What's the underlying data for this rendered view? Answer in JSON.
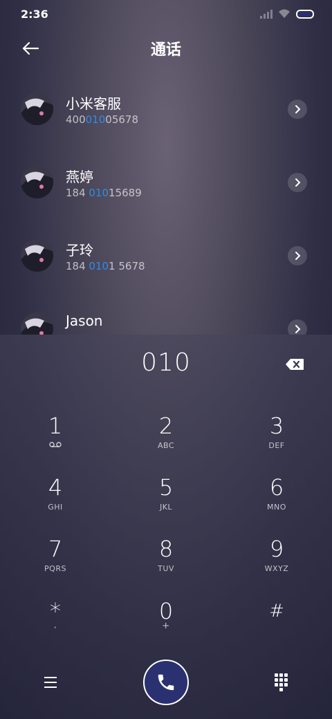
{
  "status_bar": {
    "time": "2:36"
  },
  "header": {
    "title": "通话"
  },
  "contacts": [
    {
      "name": "小米客服",
      "number_pre": "400",
      "number_hl": "010",
      "number_post": "05678"
    },
    {
      "name": "燕婷",
      "number_pre": "184 ",
      "number_hl": "010",
      "number_post": "15689"
    },
    {
      "name": "子玲",
      "number_pre": "184 ",
      "number_hl": "010",
      "number_post": "1 5678"
    },
    {
      "name": "Jason",
      "number_pre": "",
      "number_hl": "",
      "number_post": ""
    }
  ],
  "dialer": {
    "input": "010"
  },
  "keys": [
    {
      "digit": "1",
      "letters": ""
    },
    {
      "digit": "2",
      "letters": "ABC"
    },
    {
      "digit": "3",
      "letters": "DEF"
    },
    {
      "digit": "4",
      "letters": "GHI"
    },
    {
      "digit": "5",
      "letters": "JKL"
    },
    {
      "digit": "6",
      "letters": "MNO"
    },
    {
      "digit": "7",
      "letters": "PQRS"
    },
    {
      "digit": "8",
      "letters": "TUV"
    },
    {
      "digit": "9",
      "letters": "WXYZ"
    },
    {
      "digit": "*",
      "letters": ","
    },
    {
      "digit": "0",
      "letters": "+"
    },
    {
      "digit": "#",
      "letters": ""
    }
  ],
  "icons": {
    "back": "arrow-left-icon",
    "chevron": "chevron-right-icon",
    "backspace": "backspace-icon",
    "voicemail": "voicemail-icon",
    "menu": "menu-icon",
    "call": "phone-icon",
    "keypad": "keypad-grid-icon"
  },
  "colors": {
    "highlight": "#2f8de4",
    "call_button": "#2b3170"
  }
}
